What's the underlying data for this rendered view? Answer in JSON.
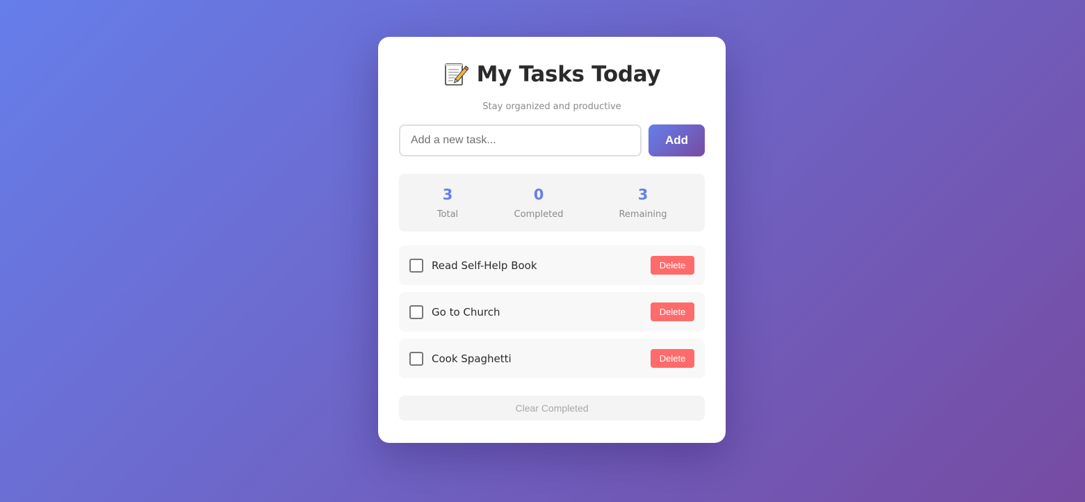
{
  "app": {
    "title": "My Tasks Today",
    "subtitle": "Stay organized and productive",
    "icon": "memo-pencil-icon"
  },
  "input": {
    "placeholder": "Add a new task...",
    "value": "",
    "add_label": "Add"
  },
  "stats": {
    "total_value": "3",
    "total_label": "Total",
    "completed_value": "0",
    "completed_label": "Completed",
    "remaining_value": "3",
    "remaining_label": "Remaining"
  },
  "tasks": [
    {
      "text": "Read Self-Help Book",
      "completed": false,
      "delete_label": "Delete"
    },
    {
      "text": "Go to Church",
      "completed": false,
      "delete_label": "Delete"
    },
    {
      "text": "Cook Spaghetti",
      "completed": false,
      "delete_label": "Delete"
    }
  ],
  "footer": {
    "clear_label": "Clear Completed"
  },
  "colors": {
    "background_start": "#667eea",
    "background_end": "#764ba2",
    "accent": "#667eea",
    "delete": "#ff6b6b"
  }
}
